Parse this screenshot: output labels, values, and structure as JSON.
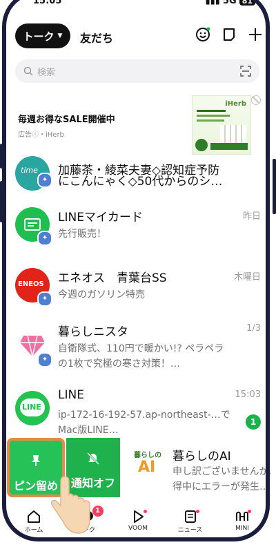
{
  "status": {
    "time": "15:05",
    "network": "5G",
    "battery": "81"
  },
  "header": {
    "talk_label": "トーク",
    "friends_label": "友だち"
  },
  "search": {
    "placeholder": "検索"
  },
  "ad": {
    "title": "毎週お得なSALE開催中",
    "sponsor": "広告ⓘ・iHerb",
    "brand": "iHerb"
  },
  "chats": [
    {
      "name": "加藤茶・綾菜夫妻◇認知症予防",
      "message": "にこんにゃく◇50代からのシ…",
      "time": "",
      "avatar_color": "#2aa6a0"
    },
    {
      "name": "LINEマイカード",
      "message": "先行販売！",
      "time": "昨日",
      "avatar_color": "#1fbf4f"
    },
    {
      "name": "エネオス　青葉台SS",
      "message": "今週のガソリン特売",
      "time": "木曜日",
      "avatar_color": "#e2231a",
      "avatar_text": "ENEOS"
    },
    {
      "name": "暮らしニスタ",
      "message": "自衛隊式、110円で暖かい!? ペラペラの1枚で究極の寒さ対策！…",
      "time": "1/3",
      "avatar_color": "#ffffff"
    },
    {
      "name": "LINE",
      "message": "ip-172-16-192-57.ap-northeast-…でMac版LINE…",
      "time": "15:03",
      "unread": "1",
      "avatar_color": "#22c34f",
      "avatar_text": "LINE"
    }
  ],
  "swipe": {
    "pin_label": "ピン留め",
    "mute_label": "通知オフ",
    "chat": {
      "name": "暮らしのAI",
      "message_line1": "申し訳ございませんが、",
      "message_line2": "得中にエラーが発生…",
      "logo_text": "暮らしの",
      "logo_ai": "AI"
    }
  },
  "tabs": [
    {
      "label": "ホーム"
    },
    {
      "label": "トーク",
      "badge": "1"
    },
    {
      "label": "VOOM"
    },
    {
      "label": "ニュース"
    },
    {
      "label": "MINI"
    }
  ],
  "colors": {
    "line_green": "#06c755",
    "pin_border": "#e8894b",
    "badge_red": "#ff3b5c"
  }
}
